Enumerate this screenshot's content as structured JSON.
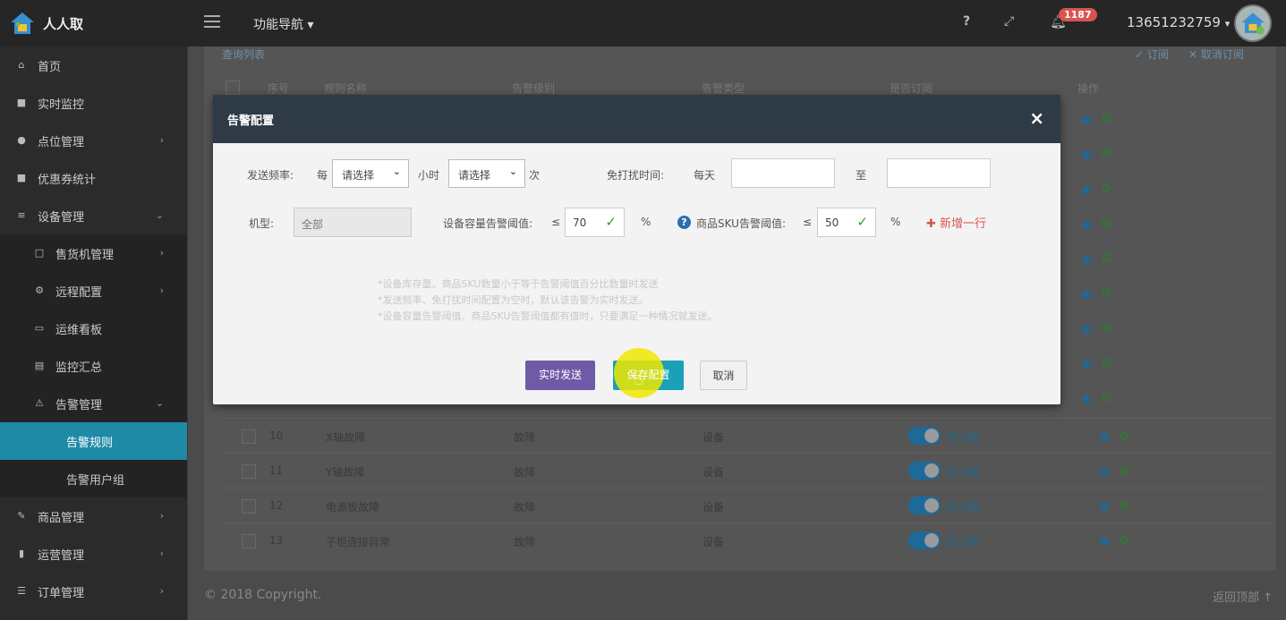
{
  "app": {
    "title": "人人取",
    "nav_menu": "功能导航",
    "notification_count": "1187",
    "user_phone": "13651232759"
  },
  "sidebar": {
    "items": [
      {
        "label": "首页",
        "icon": "home-icon"
      },
      {
        "label": "实时监控",
        "icon": "video-icon"
      },
      {
        "label": "点位管理",
        "icon": "map-marker-icon"
      },
      {
        "label": "优惠券统计",
        "icon": "stop-icon"
      },
      {
        "label": "设备管理",
        "icon": "sort-icon"
      },
      {
        "label": "售货机管理",
        "icon": "columns-icon"
      },
      {
        "label": "远程配置",
        "icon": "cogs-icon"
      },
      {
        "label": "运维看板",
        "icon": "calendar-icon"
      },
      {
        "label": "监控汇总",
        "icon": "file-icon"
      },
      {
        "label": "告警管理",
        "icon": "alarm-icon"
      },
      {
        "label": "告警规则"
      },
      {
        "label": "告警用户组"
      },
      {
        "label": "商品管理",
        "icon": "edit-icon"
      },
      {
        "label": "运营管理",
        "icon": "bookmark-icon"
      },
      {
        "label": "订单管理",
        "icon": "list-icon"
      }
    ]
  },
  "panel": {
    "title": "查询列表",
    "subscribe": "订阅",
    "unsubscribe": "取消订阅"
  },
  "table": {
    "headers": {
      "seq": "序号",
      "name": "规则名称",
      "level": "告警级别",
      "type": "告警类型",
      "subscribed": "是否订阅",
      "ops": "操作"
    },
    "rows": [
      {
        "seq": "10",
        "name": "X轴故障",
        "level": "故障",
        "type": "设备",
        "status": "已订阅"
      },
      {
        "seq": "11",
        "name": "Y轴故障",
        "level": "故障",
        "type": "设备",
        "status": "已订阅"
      },
      {
        "seq": "12",
        "name": "电源板故障",
        "level": "故障",
        "type": "设备",
        "status": "已订阅"
      },
      {
        "seq": "13",
        "name": "子柜连接异常",
        "level": "故障",
        "type": "设备",
        "status": "已订阅"
      }
    ]
  },
  "modal": {
    "title": "告警配置",
    "send_freq_label": "发送频率:",
    "every": "每",
    "select1": "请选择",
    "hour": "小时",
    "select2": "请选择",
    "times": "次",
    "dnd_label": "免打扰时间:",
    "every_day": "每天",
    "to": "至",
    "model_label": "机型:",
    "model_value": "全部",
    "capacity_label": "设备容量告警阈值:",
    "le1": "≤",
    "capacity_value": "70",
    "pct1": "%",
    "sku_label": "商品SKU告警阈值:",
    "le2": "≤",
    "sku_value": "50",
    "pct2": "%",
    "add_row": "新增一行",
    "notes": [
      "*设备库存量、商品SKU数量小于等于告警阈值百分比数量时发送",
      "*发送频率、免打扰时间配置为空时，默认该告警为实时发送。",
      "*设备容量告警阈值、商品SKU告警阈值都有值时，只要满足一种情况就发送。"
    ],
    "btn_realtime": "实时发送",
    "btn_save": "保存配置",
    "btn_cancel": "取消"
  },
  "footer": {
    "copyright": "© 2018 Copyright.",
    "back_top": "返回顶部"
  }
}
